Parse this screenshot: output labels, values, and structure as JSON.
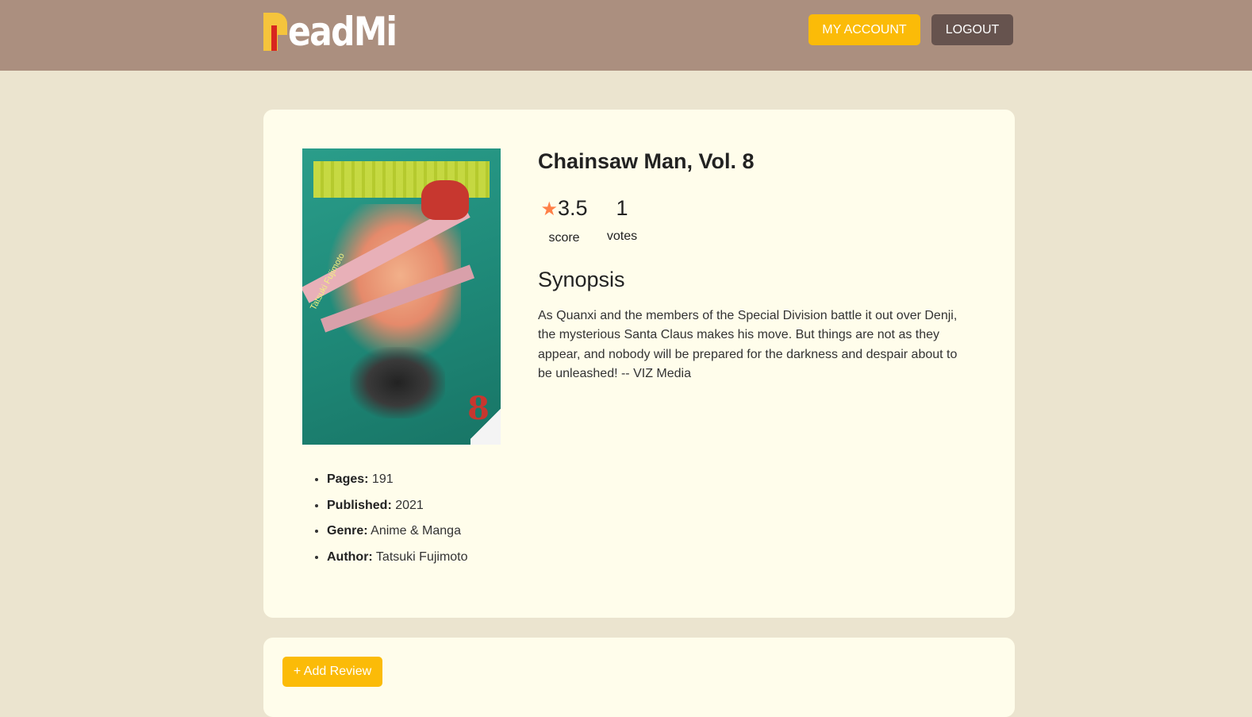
{
  "header": {
    "logo_text": "eadMi",
    "logo_full": "ReadMi",
    "my_account_label": "MY ACCOUNT",
    "logout_label": "LOGOUT"
  },
  "book": {
    "title": "Chainsaw Man, Vol. 8",
    "score": "3.5",
    "score_label": "score",
    "votes": "1",
    "votes_label": "votes",
    "synopsis_heading": "Synopsis",
    "synopsis": "As Quanxi and the members of the Special Division battle it out over Denji, the mysterious Santa Claus makes his move. But things are not as they appear, and nobody will be prepared for the darkness and despair about to be unleashed! -- VIZ Media",
    "cover_vol": "8",
    "cover_author": "Tatsuki Fujimoto",
    "details": [
      {
        "label": "Pages:",
        "value": " 191"
      },
      {
        "label": "Published:",
        "value": " 2021"
      },
      {
        "label": "Genre:",
        "value": " Anime & Manga"
      },
      {
        "label": "Author:",
        "value": " Tatsuki Fujimoto"
      }
    ]
  },
  "reviews": {
    "add_review_label": "+ Add Review"
  },
  "colors": {
    "header_bg": "#ab8f7f",
    "page_bg": "#ebe4cf",
    "card_bg": "#fffdeb",
    "accent": "#fbbb08",
    "dark_button": "#66534e",
    "star": "#ff8048"
  }
}
